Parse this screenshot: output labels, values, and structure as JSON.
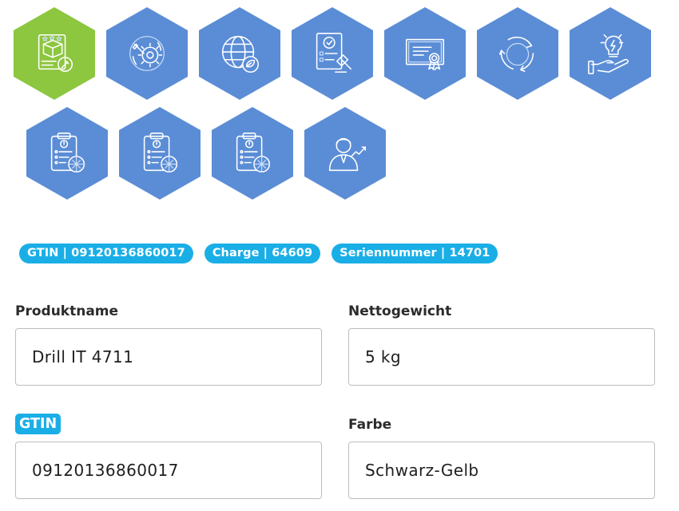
{
  "colors": {
    "hex_active": "#8dc63f",
    "hex_default": "#5b8dd6",
    "tag_background": "#1aaee6",
    "label_text": "#2b2b2b",
    "input_border": "#bdbdbd"
  },
  "icon_tiles": [
    {
      "icon": "product-box-rating-icon",
      "active": true
    },
    {
      "icon": "gear-tools-icon",
      "active": false
    },
    {
      "icon": "globe-leaf-icon",
      "active": false
    },
    {
      "icon": "checklist-gavel-icon",
      "active": false
    },
    {
      "icon": "certificate-icon",
      "active": false
    },
    {
      "icon": "recycle-cycle-icon",
      "active": false
    },
    {
      "icon": "hand-lightbulb-icon",
      "active": false
    },
    {
      "icon": "clipboard-warning-icon",
      "active": false
    },
    {
      "icon": "clipboard-warning-icon",
      "active": false
    },
    {
      "icon": "clipboard-warning-icon",
      "active": false
    },
    {
      "icon": "person-growth-icon",
      "active": false
    }
  ],
  "tags": [
    {
      "text": "GTIN | 09120136860017"
    },
    {
      "text": "Charge | 64609"
    },
    {
      "text": "Seriennummer | 14701"
    }
  ],
  "fields": {
    "product_name": {
      "label": "Produktname",
      "value": "Drill IT 4711"
    },
    "net_weight": {
      "label": "Nettogewicht",
      "value": "5 kg"
    },
    "gtin": {
      "label": "GTIN",
      "value": "09120136860017"
    },
    "color": {
      "label": "Farbe",
      "value": "Schwarz-Gelb"
    }
  }
}
